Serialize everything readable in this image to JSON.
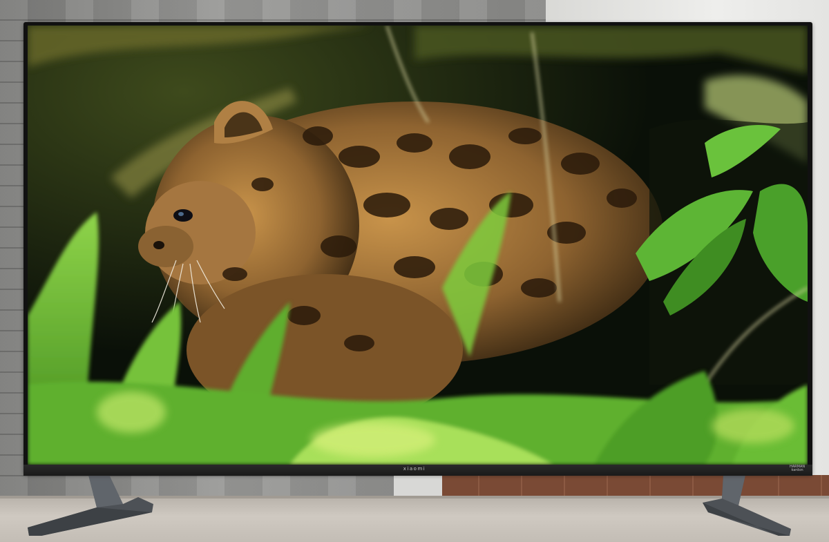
{
  "tv": {
    "brand": "xiaomi",
    "audio_badge_line1": "HARMAN",
    "audio_badge_line2": "kardon"
  },
  "screen": {
    "subject": "spotted-wildcat-kitten",
    "scene": "cub-among-grass-leaves"
  },
  "colors": {
    "foliage": "#6fb833",
    "fur": "#a8773a",
    "background_dark": "#0b1209"
  }
}
